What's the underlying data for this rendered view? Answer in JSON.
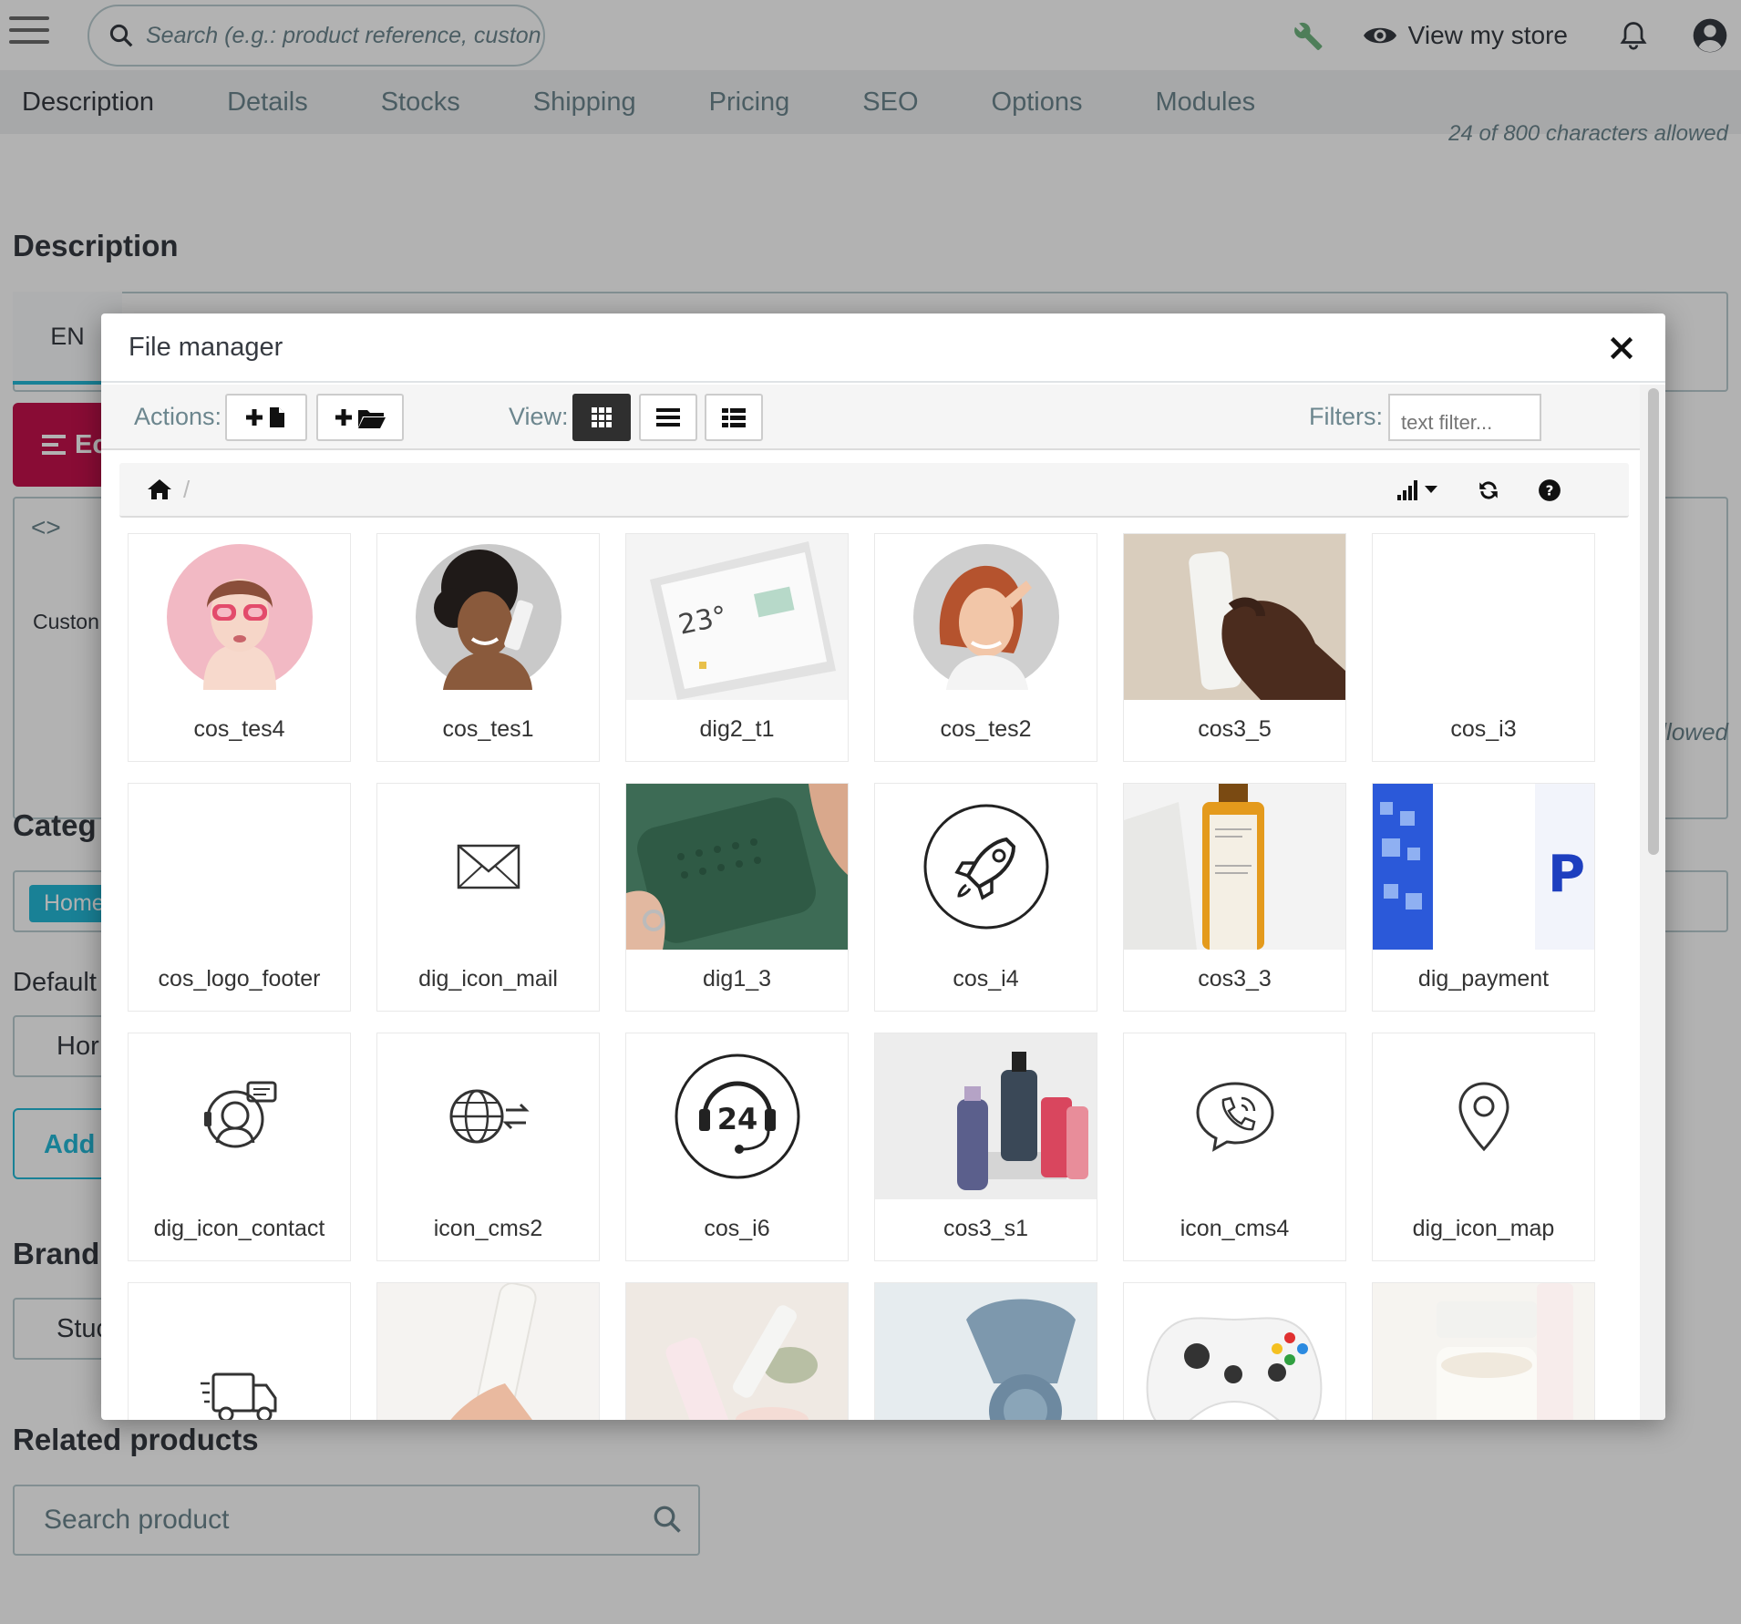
{
  "header": {
    "search_placeholder": "Search (e.g.: product reference, custon",
    "view_store": "View my store"
  },
  "tabs": [
    "Description",
    "Details",
    "Stocks",
    "Shipping",
    "Pricing",
    "SEO",
    "Options",
    "Modules"
  ],
  "page": {
    "chars_allowed_cut": "24 of 800 characters allowed",
    "description_title": "Description",
    "lang": "EN",
    "edit_label": "Ec",
    "customer_cut": "Custon",
    "allowed_cut": "llowed",
    "categories_cut": "Categ",
    "home_pill": "Home",
    "default_cut": "Default",
    "default_value_cut": "Hor",
    "add_cut": "Add",
    "brand_cut": "Brand",
    "brand_value_cut": "Stuc",
    "related_title": "Related products",
    "search_product_placeholder": "Search product"
  },
  "modal": {
    "title": "File manager",
    "actions_label": "Actions:",
    "view_label": "View:",
    "filters_label": "Filters:",
    "filter_placeholder": "text filter...",
    "files": [
      {
        "name": "cos_tes4",
        "icon": "portrait-pink-glasses"
      },
      {
        "name": "cos_tes1",
        "icon": "portrait-curly-hair"
      },
      {
        "name": "dig2_t1",
        "icon": "smart-display-23"
      },
      {
        "name": "cos_tes2",
        "icon": "portrait-red-hair"
      },
      {
        "name": "cos3_5",
        "icon": "hand-holding-tube"
      },
      {
        "name": "cos_i3",
        "icon": "blank"
      },
      {
        "name": "cos_logo_footer",
        "icon": "blank"
      },
      {
        "name": "dig_icon_mail",
        "icon": "mail-icon"
      },
      {
        "name": "dig1_3",
        "icon": "green-speaker"
      },
      {
        "name": "cos_i4",
        "icon": "rocket-icon"
      },
      {
        "name": "cos3_3",
        "icon": "amber-bottle"
      },
      {
        "name": "dig_payment",
        "icon": "payment-logos"
      },
      {
        "name": "dig_icon_contact",
        "icon": "contact-headset-icon"
      },
      {
        "name": "icon_cms2",
        "icon": "globe-arrows-icon"
      },
      {
        "name": "cos_i6",
        "icon": "support-24-icon"
      },
      {
        "name": "cos3_s1",
        "icon": "cosmetic-bottles"
      },
      {
        "name": "icon_cms4",
        "icon": "phone-bubble-icon"
      },
      {
        "name": "dig_icon_map",
        "icon": "map-pin-icon"
      },
      {
        "name": "",
        "icon": "delivery-truck-icon"
      },
      {
        "name": "",
        "icon": "hand-with-tube"
      },
      {
        "name": "",
        "icon": "cream-products"
      },
      {
        "name": "",
        "icon": "blue-device"
      },
      {
        "name": "",
        "icon": "game-controller"
      },
      {
        "name": "",
        "icon": "cream-jar"
      }
    ]
  },
  "colors": {
    "accent": "#25b9d7",
    "edit_button": "#c5124d",
    "wrench": "#70b580"
  }
}
